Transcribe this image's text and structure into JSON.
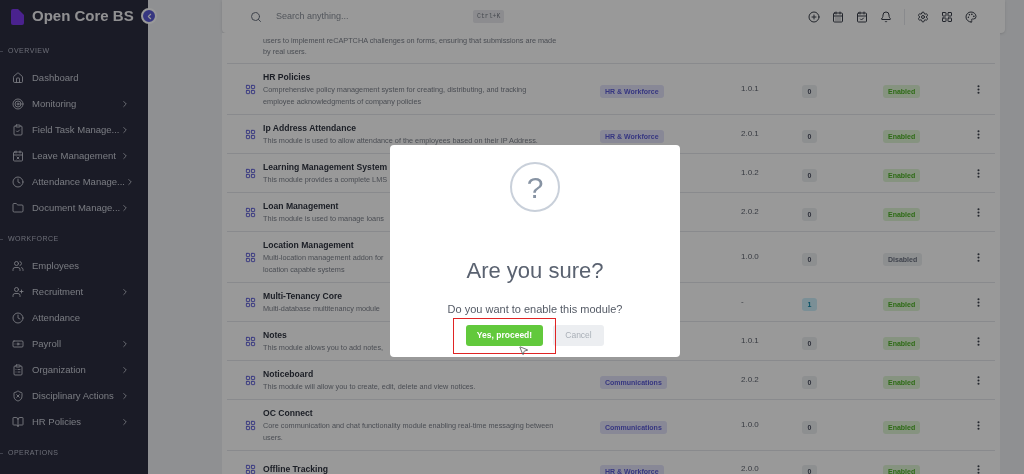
{
  "brand": {
    "title": "Open Core BS"
  },
  "sidebar": {
    "sections": [
      {
        "label": "OVERVIEW",
        "items": [
          {
            "label": "Dashboard",
            "has_children": false
          },
          {
            "label": "Monitoring",
            "has_children": true
          },
          {
            "label": "Field Task Manage...",
            "has_children": true
          },
          {
            "label": "Leave Management",
            "has_children": true
          },
          {
            "label": "Attendance Manage...",
            "has_children": true
          },
          {
            "label": "Document Manage...",
            "has_children": true
          }
        ]
      },
      {
        "label": "WORKFORCE",
        "items": [
          {
            "label": "Employees",
            "has_children": false
          },
          {
            "label": "Recruitment",
            "has_children": true
          },
          {
            "label": "Attendance",
            "has_children": false
          },
          {
            "label": "Payroll",
            "has_children": true
          },
          {
            "label": "Organization",
            "has_children": true
          },
          {
            "label": "Disciplinary Actions",
            "has_children": true
          },
          {
            "label": "HR Policies",
            "has_children": true
          }
        ]
      },
      {
        "label": "OPERATIONS"
      }
    ]
  },
  "header": {
    "search": {
      "placeholder": "Search anything..."
    },
    "shortcut": "Ctrl+K"
  },
  "modules": [
    {
      "description": [
        "users to implement reCAPTCHA challenges on forms, ensuring that submissions are made",
        "by real users."
      ]
    },
    {
      "name": "HR Policies",
      "description": [
        "Comprehensive policy management system for creating, distributing, and tracking",
        "employee acknowledgments of company policies"
      ],
      "category": "HR & Workforce",
      "version": "1.0.1",
      "count": {
        "text": "0",
        "highlighted": false
      },
      "enabled": true,
      "status": "Enabled"
    },
    {
      "name": "Ip Address Attendance",
      "description": [
        "This module is used to allow attendance of the employees based on their IP Address."
      ],
      "category": "HR & Workforce",
      "version": "2.0.1",
      "count": {
        "text": "0",
        "highlighted": false
      },
      "enabled": true,
      "status": "Enabled"
    },
    {
      "name": "Learning Management System",
      "description": [
        "This module provides a complete LMS"
      ],
      "version": "1.0.2",
      "count": {
        "text": "0",
        "highlighted": false
      },
      "enabled": true,
      "status": "Enabled"
    },
    {
      "name": "Loan Management",
      "description": [
        "This module is used to manage loans"
      ],
      "version": "2.0.2",
      "count": {
        "text": "0",
        "highlighted": false
      },
      "enabled": true,
      "status": "Enabled"
    },
    {
      "name": "Location Management",
      "description": [
        "Multi-location management addon for",
        "location capable systems"
      ],
      "version": "1.0.0",
      "count": {
        "text": "0",
        "highlighted": false
      },
      "enabled": false,
      "status": "Disabled"
    },
    {
      "name": "Multi-Tenancy Core",
      "description": [
        "Multi-database multitenancy module"
      ],
      "version": "-",
      "count": {
        "text": "1",
        "highlighted": true
      },
      "enabled": true,
      "status": "Enabled"
    },
    {
      "name": "Notes",
      "description": [
        "This module allows you to add notes,"
      ],
      "version": "1.0.1",
      "count": {
        "text": "0",
        "highlighted": false
      },
      "enabled": true,
      "status": "Enabled"
    },
    {
      "name": "Noticeboard",
      "description": [
        "This module will allow you to create, edit, delete and view notices."
      ],
      "category": "Communications",
      "version": "2.0.2",
      "count": {
        "text": "0",
        "highlighted": false
      },
      "enabled": true,
      "status": "Enabled"
    },
    {
      "name": "OC Connect",
      "description": [
        "Core communication and chat functionality module enabling real-time messaging between",
        "users."
      ],
      "category": "Communications",
      "version": "1.0.0",
      "count": {
        "text": "0",
        "highlighted": false
      },
      "enabled": true,
      "status": "Enabled"
    },
    {
      "name": "Offline Tracking",
      "category": "HR & Workforce",
      "version": "2.0.0",
      "count": {
        "text": "0",
        "highlighted": false
      },
      "enabled": true,
      "status": "Enabled"
    }
  ],
  "dialog": {
    "icon": "?",
    "title": "Are you sure?",
    "message": "Do you want to enable this module?",
    "confirm": "Yes, proceed!",
    "cancel": "Cancel"
  }
}
